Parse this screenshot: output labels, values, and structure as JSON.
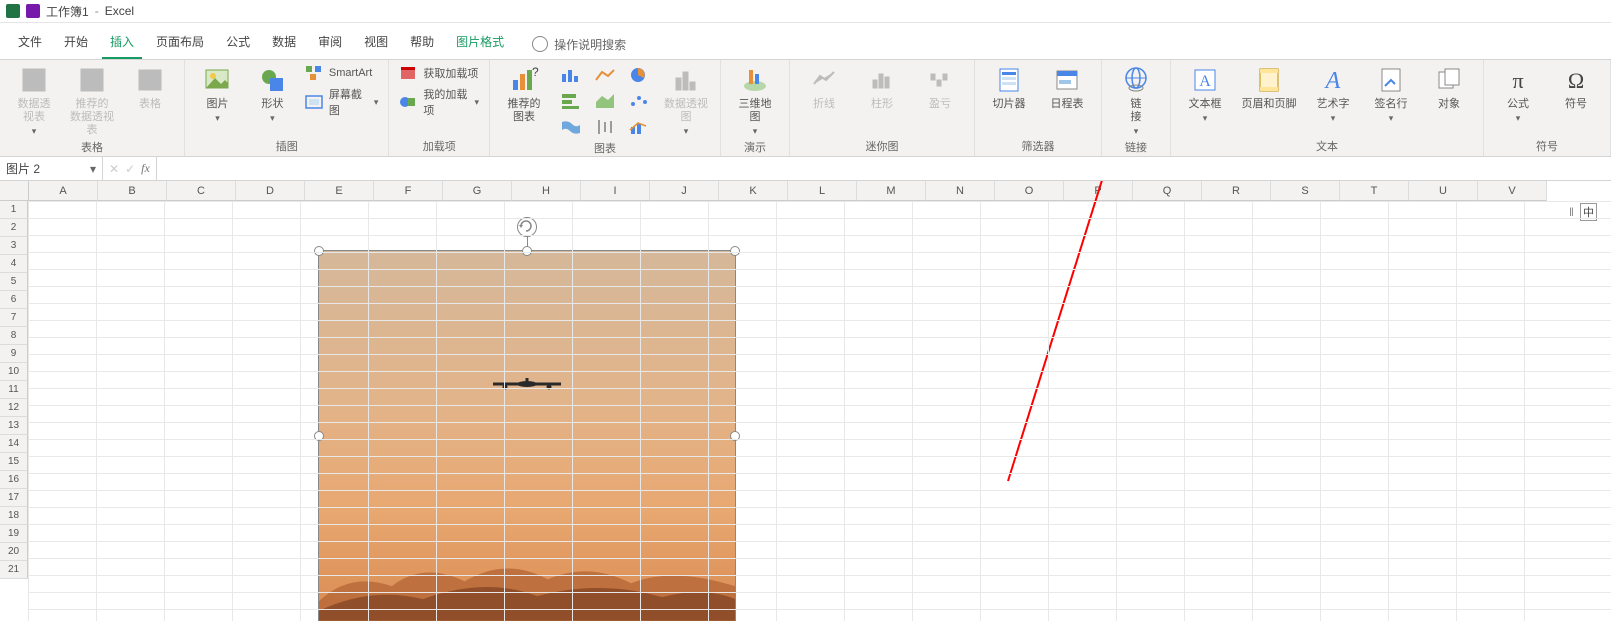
{
  "title": {
    "workbook": "工作簿1",
    "app": "Excel"
  },
  "tabs": {
    "file": "文件",
    "home": "开始",
    "insert": "插入",
    "layout": "页面布局",
    "formulas": "公式",
    "data": "数据",
    "review": "审阅",
    "view": "视图",
    "help": "帮助",
    "picfmt": "图片格式"
  },
  "tellme": "操作说明搜索",
  "ribbon": {
    "tables": {
      "pivot": "数据透\n视表",
      "recpivot": "推荐的\n数据透视表",
      "table": "表格",
      "label": "表格"
    },
    "illus": {
      "pic": "图片",
      "shapes": "形状",
      "smartart": "SmartArt",
      "screenshot": "屏幕截图",
      "label": "插图"
    },
    "addins": {
      "get": "获取加载项",
      "my": "我的加载项",
      "label": "加载项"
    },
    "charts": {
      "rec": "推荐的\n图表",
      "pivotchart": "数据透视图",
      "label": "图表"
    },
    "map3d": {
      "btn": "三维地\n图",
      "label": "演示"
    },
    "spark": {
      "line": "折线",
      "col": "柱形",
      "winloss": "盈亏",
      "label": "迷你图"
    },
    "filter": {
      "slicer": "切片器",
      "timeline": "日程表",
      "label": "筛选器"
    },
    "link": {
      "btn": "链\n接",
      "label": "链接"
    },
    "text": {
      "textbox": "文本框",
      "hf": "页眉和页脚",
      "wordart": "艺术字",
      "sig": "签名行",
      "obj": "对象",
      "label": "文本"
    },
    "symbols": {
      "eq": "公式",
      "sym": "符号",
      "label": "符号"
    }
  },
  "namebox": "图片 2",
  "cols": [
    "A",
    "B",
    "C",
    "D",
    "E",
    "F",
    "G",
    "H",
    "I",
    "J",
    "K",
    "L",
    "M",
    "N",
    "O",
    "P",
    "Q",
    "R",
    "S",
    "T",
    "U",
    "V"
  ],
  "rows": [
    "1",
    "2",
    "3",
    "4",
    "5",
    "6",
    "7",
    "8",
    "9",
    "10",
    "11",
    "12",
    "13",
    "14",
    "15",
    "16",
    "17",
    "18",
    "19",
    "20",
    "21"
  ],
  "ime": "中"
}
